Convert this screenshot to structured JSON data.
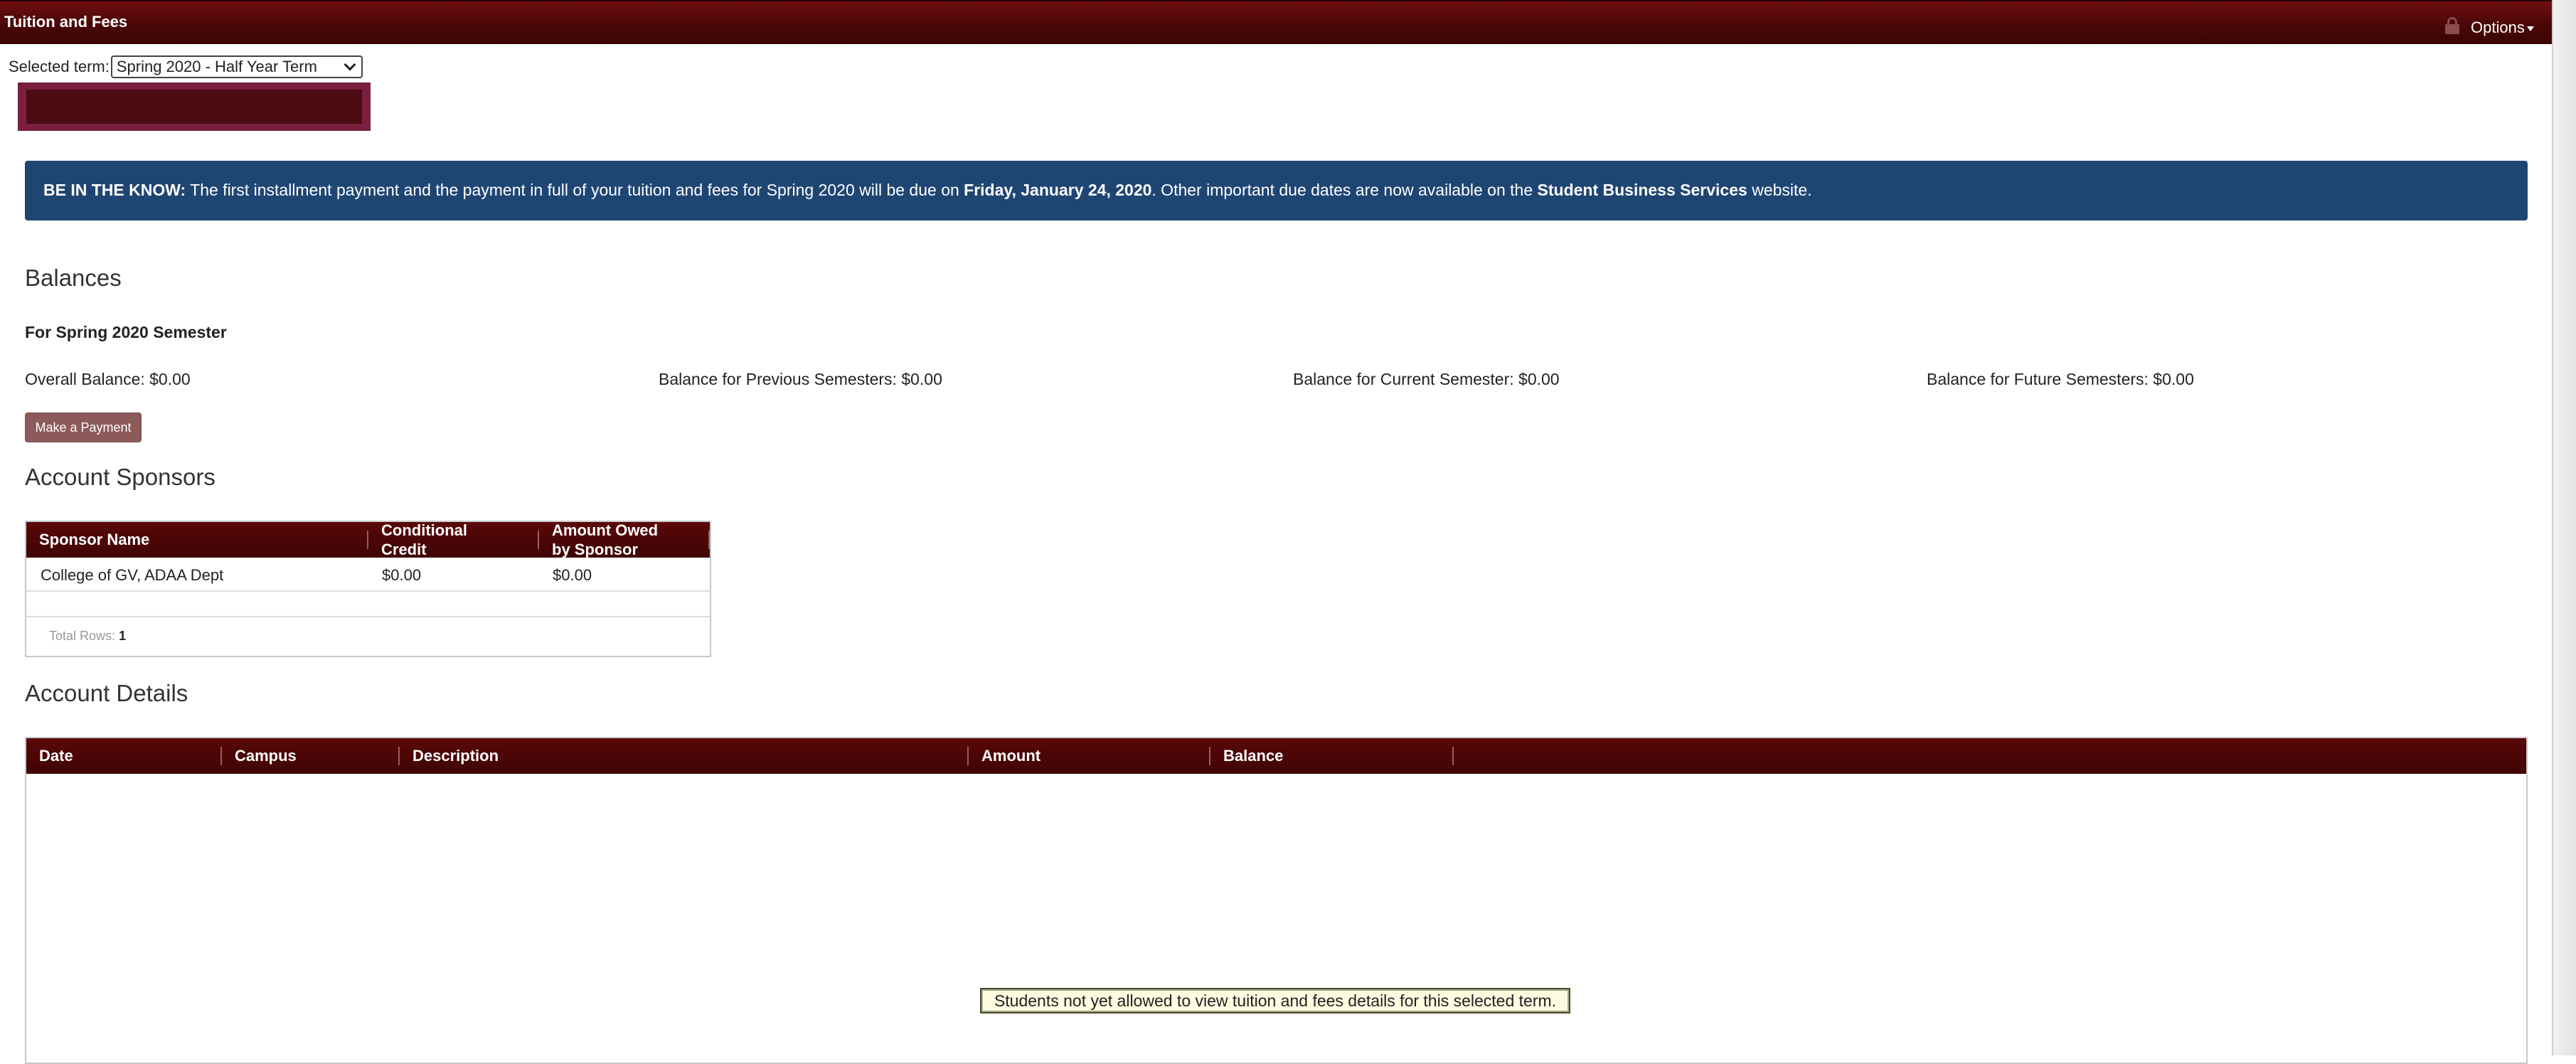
{
  "titlebar": {
    "title": "Tuition and Fees",
    "options_label": "Options"
  },
  "term": {
    "label": "Selected term:",
    "selected": "Spring 2020 - Half Year Term"
  },
  "banner": {
    "lead": "BE IN THE KNOW:",
    "text1": " The first installment payment and the payment in full of your tuition and fees for Spring 2020 will be due on ",
    "date": "Friday, January 24, 2020",
    "text2": ". Other important due dates are now available on the ",
    "link": "Student Business Services",
    "text3": " website."
  },
  "balances": {
    "heading": "Balances",
    "subheading": "For Spring 2020 Semester",
    "overall": "Overall Balance: $0.00",
    "previous": "Balance for Previous Semesters: $0.00",
    "current": "Balance for Current Semester: $0.00",
    "future": "Balance for Future Semesters: $0.00",
    "pay_button": "Make a Payment"
  },
  "sponsors": {
    "heading": "Account Sponsors",
    "columns": [
      "Sponsor Name",
      "Conditional Credit",
      "Amount Owed by Sponsor"
    ],
    "col_lines": [
      [
        "Sponsor Name"
      ],
      [
        "Conditional",
        "Credit"
      ],
      [
        "Amount Owed",
        "by Sponsor"
      ]
    ],
    "rows": [
      [
        "College of GV, ADAA Dept",
        "$0.00",
        "$0.00"
      ]
    ],
    "total_label": "Total Rows:",
    "total_value": "1"
  },
  "details": {
    "heading": "Account Details",
    "columns": [
      "Date",
      "Campus",
      "Description",
      "Amount",
      "Balance"
    ],
    "empty_message": "Students not yet allowed to view tuition and fees details for this selected term."
  },
  "colors": {
    "titlebar": "#4a0707",
    "banner": "#1f4573",
    "table_header": "#4a0606",
    "pay_button": "#8c5a59",
    "redacted_outer": "#7a1f3d",
    "redacted_inner": "#4a0b12"
  }
}
